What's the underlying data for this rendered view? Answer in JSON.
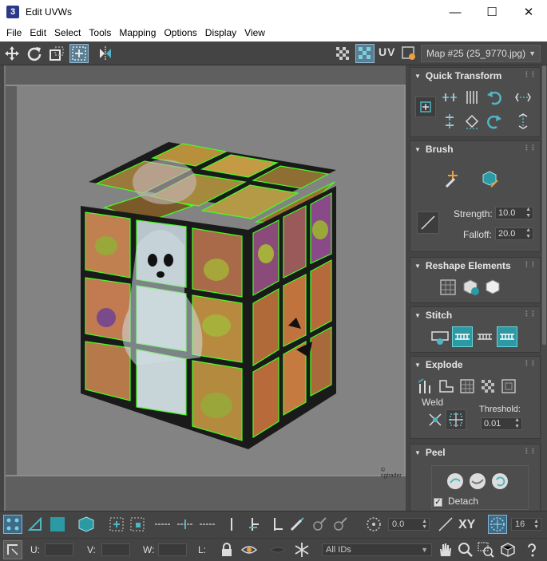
{
  "window": {
    "app_icon": "3",
    "title": "Edit UVWs",
    "minimize": "—",
    "maximize": "☐",
    "close": "✕"
  },
  "menu": [
    "File",
    "Edit",
    "Select",
    "Tools",
    "Mapping",
    "Options",
    "Display",
    "View"
  ],
  "toolbar_top": {
    "uv_label": "UV",
    "map_dropdown": "Map #25 (25_9770.jpg)"
  },
  "viewport": {
    "watermark": "© cgtrader"
  },
  "panel": {
    "quick_transform": {
      "title": "Quick Transform"
    },
    "brush": {
      "title": "Brush",
      "strength_label": "Strength:",
      "strength_value": "10.0",
      "falloff_label": "Falloff:",
      "falloff_value": "20.0"
    },
    "reshape": {
      "title": "Reshape Elements"
    },
    "stitch": {
      "title": "Stitch"
    },
    "explode": {
      "title": "Explode",
      "weld_label": "Weld",
      "threshold_label": "Threshold:",
      "threshold_value": "0.01"
    },
    "peel": {
      "title": "Peel",
      "detach_label": "Detach",
      "detach_checked": true
    }
  },
  "toolbar_bottom": {
    "rotate_value": "0.0",
    "xy_label": "XY",
    "grid_value": "16",
    "u_label": "U:",
    "v_label": "V:",
    "w_label": "W:",
    "l_label": "L:",
    "id_filter": "All IDs"
  },
  "colors": {
    "accent_teal": "#2b9aa5",
    "ui_dark": "#444444",
    "selection_green": "#44ff22"
  }
}
